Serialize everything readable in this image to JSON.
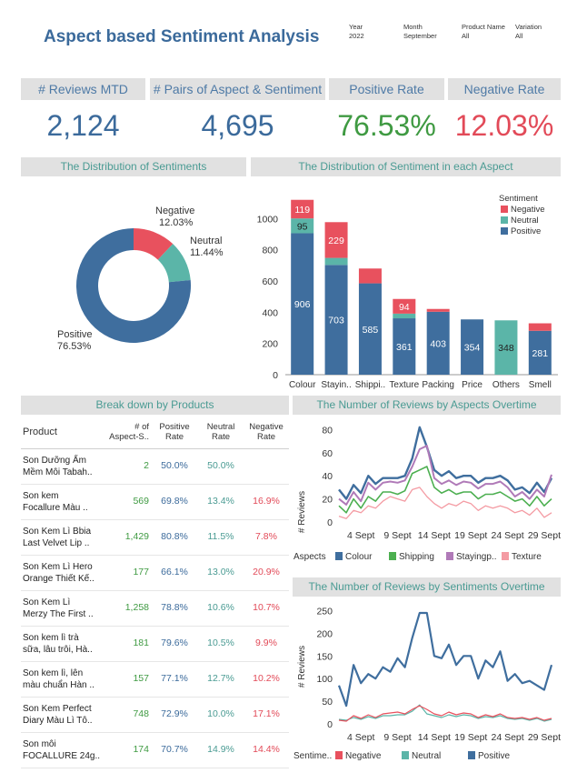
{
  "header": {
    "title": "Aspect based Sentiment Analysis",
    "filters": [
      {
        "label": "Year",
        "value": "2022"
      },
      {
        "label": "Month",
        "value": "September"
      },
      {
        "label": "Product Name",
        "value": "All"
      },
      {
        "label": "Variation",
        "value": "All"
      }
    ]
  },
  "kpis": [
    {
      "label": "# Reviews MTD",
      "value": "2,124",
      "color": "#3b6a9b"
    },
    {
      "label": "# Pairs of Aspect & Sentiment",
      "value": "4,695",
      "color": "#3b6a9b"
    },
    {
      "label": "Positive Rate",
      "value": "76.53%",
      "color": "#3f9a42"
    },
    {
      "label": "Negative Rate",
      "value": "12.03%",
      "color": "#e24a58"
    }
  ],
  "colors": {
    "negative": "#e8515e",
    "neutral": "#5bb5a8",
    "positive": "#3f6e9e",
    "colour": "#3f6e9e",
    "shipping": "#4caf50",
    "staying": "#b07ab8",
    "texture": "#f49ba3"
  },
  "donut": {
    "title": "The Distribution of Sentiments",
    "chart_data": {
      "type": "pie",
      "labels": [
        "Negative",
        "Neutral",
        "Positive"
      ],
      "values": [
        12.03,
        11.44,
        76.53
      ],
      "value_labels": [
        "12.03%",
        "11.44%",
        "76.53%"
      ]
    }
  },
  "aspect_bar": {
    "title": "The Distribution of  Sentiment in each Aspect",
    "legend_title": "Sentiment",
    "legend": [
      "Negative",
      "Neutral",
      "Positive"
    ],
    "chart_data": {
      "type": "bar",
      "stacked": true,
      "categories": [
        "Colour",
        "Stayin..",
        "Shippi..",
        "Texture",
        "Packing",
        "Price",
        "Others",
        "Smell"
      ],
      "series": [
        {
          "name": "Positive",
          "values": [
            906,
            703,
            585,
            361,
            403,
            354,
            0,
            281
          ],
          "labels": [
            "906",
            "703",
            "585",
            "361",
            "403",
            "354",
            "",
            "281"
          ]
        },
        {
          "name": "Neutral",
          "values": [
            95,
            45,
            0,
            30,
            0,
            0,
            348,
            0
          ],
          "labels": [
            "95",
            "",
            "",
            "",
            "",
            "",
            "348",
            ""
          ]
        },
        {
          "name": "Negative",
          "values": [
            119,
            229,
            95,
            94,
            18,
            0,
            0,
            48
          ],
          "labels": [
            "119",
            "229",
            "",
            "94",
            "",
            "",
            "",
            ""
          ]
        }
      ],
      "yticks": [
        0,
        200,
        400,
        600,
        800,
        1000
      ],
      "ylim": [
        0,
        1200
      ]
    }
  },
  "products": {
    "title": "Break down by Products",
    "columns": [
      "Product",
      "# of Aspect-S..",
      "Positive Rate",
      "Neutral Rate",
      "Negative Rate"
    ],
    "rows": [
      {
        "name1": "Son Dưỡng Ẩm",
        "name2": "Mềm Môi Tabah..",
        "count": "2",
        "pos": "50.0%",
        "neu": "50.0%",
        "neg": ""
      },
      {
        "name1": "Son kem",
        "name2": "Focallure Màu ..",
        "count": "569",
        "pos": "69.8%",
        "neu": "13.4%",
        "neg": "16.9%"
      },
      {
        "name1": "Son Kem Lì Bbia",
        "name2": "Last Velvet Lip ..",
        "count": "1,429",
        "pos": "80.8%",
        "neu": "11.5%",
        "neg": "7.8%"
      },
      {
        "name1": "Son Kem Lì Hero",
        "name2": "Orange Thiết Kế..",
        "count": "177",
        "pos": "66.1%",
        "neu": "13.0%",
        "neg": "20.9%"
      },
      {
        "name1": "Son Kem Lì",
        "name2": "Merzy The First ..",
        "count": "1,258",
        "pos": "78.8%",
        "neu": "10.6%",
        "neg": "10.7%"
      },
      {
        "name1": "Son kem lì trà",
        "name2": "sữa, lâu trôi, Hà..",
        "count": "181",
        "pos": "79.6%",
        "neu": "10.5%",
        "neg": "9.9%"
      },
      {
        "name1": "Son kem lì, lên",
        "name2": "màu chuẩn Hàn ..",
        "count": "157",
        "pos": "77.1%",
        "neu": "12.7%",
        "neg": "10.2%"
      },
      {
        "name1": "Son Kem Perfect",
        "name2": "Diary Màu Lì Tô..",
        "count": "748",
        "pos": "72.9%",
        "neu": "10.0%",
        "neg": "17.1%"
      },
      {
        "name1": "Son môi",
        "name2": "FOCALLURE 24g..",
        "count": "174",
        "pos": "70.7%",
        "neu": "14.9%",
        "neg": "14.4%"
      }
    ]
  },
  "aspects_over_time": {
    "title": "The Number of Reviews by Aspects Overtime",
    "ylabel": "# Reviews",
    "legend_title": "Aspects",
    "legend": [
      "Colour",
      "Shipping",
      "Stayingp..",
      "Texture"
    ],
    "xtick_labels": [
      "4 Sept",
      "9 Sept",
      "14 Sept",
      "19 Sept",
      "24 Sept",
      "29 Sept"
    ],
    "chart_data": {
      "type": "line",
      "x": [
        1,
        2,
        3,
        4,
        5,
        6,
        7,
        8,
        9,
        10,
        11,
        12,
        13,
        14,
        15,
        16,
        17,
        18,
        19,
        20,
        21,
        22,
        23,
        24,
        25,
        26,
        27,
        28,
        29,
        30
      ],
      "xticks": [
        4,
        9,
        14,
        19,
        24,
        29
      ],
      "yticks": [
        0,
        20,
        40,
        60,
        80
      ],
      "ylim": [
        0,
        85
      ],
      "series": [
        {
          "name": "Colour",
          "values": [
            28,
            20,
            32,
            25,
            40,
            33,
            38,
            38,
            38,
            40,
            55,
            82,
            65,
            45,
            40,
            44,
            38,
            40,
            40,
            34,
            38,
            38,
            40,
            36,
            28,
            30,
            25,
            34,
            26,
            38
          ]
        },
        {
          "name": "Shipping",
          "values": [
            14,
            8,
            20,
            12,
            22,
            18,
            26,
            26,
            24,
            27,
            42,
            45,
            48,
            30,
            25,
            28,
            24,
            26,
            26,
            20,
            24,
            24,
            26,
            22,
            18,
            20,
            14,
            22,
            14,
            20
          ]
        },
        {
          "name": "Stayingp..",
          "values": [
            20,
            15,
            26,
            18,
            34,
            28,
            34,
            35,
            34,
            36,
            48,
            63,
            66,
            38,
            33,
            36,
            32,
            35,
            34,
            29,
            33,
            33,
            35,
            30,
            22,
            26,
            20,
            28,
            22,
            41
          ]
        },
        {
          "name": "Texture",
          "values": [
            5,
            3,
            10,
            8,
            14,
            12,
            18,
            22,
            20,
            18,
            28,
            30,
            22,
            16,
            12,
            16,
            14,
            18,
            16,
            10,
            14,
            12,
            14,
            12,
            8,
            10,
            6,
            12,
            4,
            8
          ]
        }
      ]
    }
  },
  "sentiments_over_time": {
    "title": "The Number of Reviews by Sentiments Overtime",
    "ylabel": "# Reviews",
    "legend_title": "Sentime..",
    "legend": [
      "Negative",
      "Neutral",
      "Positive"
    ],
    "xtick_labels": [
      "4 Sept",
      "9 Sept",
      "14 Sept",
      "19 Sept",
      "24 Sept",
      "29 Sept"
    ],
    "chart_data": {
      "type": "line",
      "x": [
        1,
        2,
        3,
        4,
        5,
        6,
        7,
        8,
        9,
        10,
        11,
        12,
        13,
        14,
        15,
        16,
        17,
        18,
        19,
        20,
        21,
        22,
        23,
        24,
        25,
        26,
        27,
        28,
        29,
        30
      ],
      "xticks": [
        4,
        9,
        14,
        19,
        24,
        29
      ],
      "yticks": [
        0,
        50,
        100,
        150,
        200,
        250
      ],
      "ylim": [
        0,
        265
      ],
      "series": [
        {
          "name": "Positive",
          "values": [
            85,
            40,
            130,
            90,
            110,
            100,
            125,
            115,
            145,
            125,
            190,
            245,
            245,
            150,
            145,
            175,
            130,
            150,
            150,
            100,
            140,
            125,
            160,
            95,
            110,
            90,
            95,
            85,
            75,
            130
          ]
        },
        {
          "name": "Neutral",
          "values": [
            10,
            8,
            14,
            10,
            16,
            12,
            18,
            18,
            20,
            20,
            28,
            42,
            22,
            18,
            14,
            20,
            16,
            20,
            18,
            12,
            16,
            14,
            18,
            12,
            10,
            12,
            8,
            12,
            6,
            10
          ]
        },
        {
          "name": "Negative",
          "values": [
            8,
            6,
            18,
            12,
            20,
            14,
            22,
            24,
            26,
            22,
            32,
            40,
            32,
            22,
            18,
            26,
            20,
            24,
            22,
            14,
            20,
            16,
            22,
            14,
            12,
            14,
            10,
            14,
            8,
            12
          ]
        }
      ]
    }
  }
}
